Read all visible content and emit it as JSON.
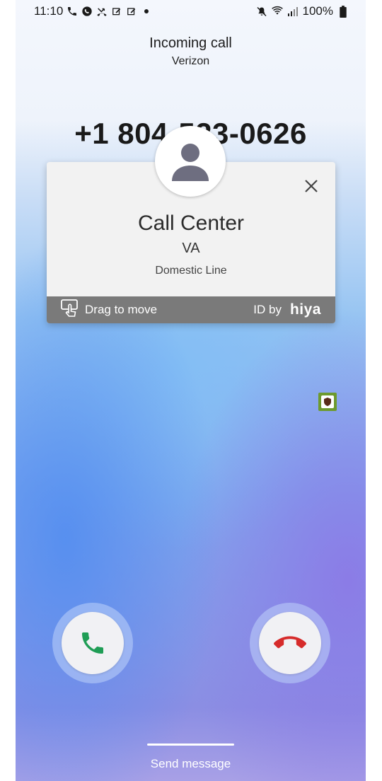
{
  "status_bar": {
    "time": "11:10",
    "battery": "100%",
    "icons_left": [
      "phone-icon",
      "whatsapp-icon",
      "missed-call-icon",
      "edit-note-icon",
      "edit-note-icon",
      "dot-icon"
    ],
    "icons_right": [
      "mute-icon",
      "wifi-icon",
      "signal-icon",
      "battery-icon"
    ]
  },
  "call": {
    "title": "Incoming call",
    "carrier": "Verizon",
    "number": "+1 804-523-0626"
  },
  "caller_card": {
    "name": "Call Center",
    "region": "VA",
    "line_type": "Domestic Line",
    "drag_label": "Drag to move",
    "id_by_label": "ID by",
    "brand": "hiya"
  },
  "actions": {
    "accept": "accept-call-button",
    "decline": "decline-call-button",
    "send_message": "Send message"
  },
  "colors": {
    "accept": "#1f9d55",
    "decline": "#d62b2b",
    "card_footer": "#7a7a7a",
    "avatar": "#6e6e80"
  }
}
